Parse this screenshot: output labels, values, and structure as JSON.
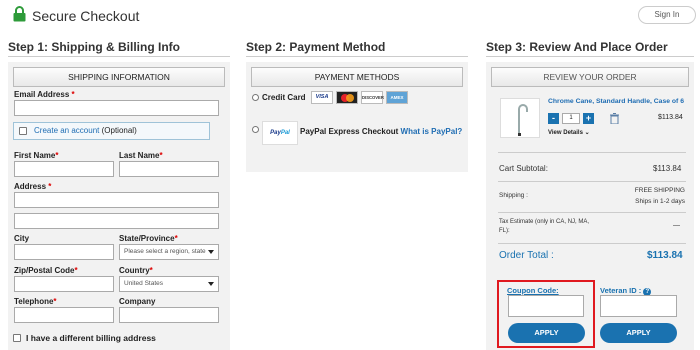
{
  "header": {
    "brand": "Secure Checkout",
    "signin": "Sign In"
  },
  "steps": {
    "step1": "Step 1: Shipping & Billing Info",
    "step2": "Step 2: Payment Method",
    "step3": "Step 3: Review And Place Order"
  },
  "shipping": {
    "panel_button": "SHIPPING INFORMATION",
    "email_label": "Email Address",
    "create_account": "Create an account",
    "optional": "(Optional)",
    "first_name": "First Name",
    "last_name": "Last Name",
    "address": "Address",
    "city": "City",
    "state": "State/Province",
    "state_placeholder": "Please select a region, state",
    "zip": "Zip/Postal Code",
    "country": "Country",
    "country_value": "United States",
    "telephone": "Telephone",
    "company": "Company",
    "billing_checkbox": "I have a different billing address",
    "required_mark": "*"
  },
  "payment": {
    "panel_button": "PAYMENT METHODS",
    "credit_card": "Credit Card",
    "paypal_label": "PayPal Express Checkout",
    "paypal_link": "What is PayPal?",
    "cards": [
      "VISA",
      "MC",
      "DISCOVER",
      "AMEX"
    ]
  },
  "review": {
    "panel_button": "REVIEW YOUR ORDER",
    "product_name": "Chrome Cane, Standard Handle, Case of 6",
    "quantity": "1",
    "price": "$113.84",
    "view_details": "View Details",
    "cart_subtotal_label": "Cart Subtotal:",
    "cart_subtotal_value": "$113.84",
    "shipping_label": "Shipping :",
    "shipping_value_1": "FREE SHIPPING",
    "shipping_value_2": "Ships in 1-2 days",
    "tax_label": "Tax Estimate (only in CA, NJ, MA, FL):",
    "tax_value": "—",
    "order_total_label": "Order Total :",
    "order_total_value": "$113.84",
    "coupon_label": "Coupon Code:",
    "veteran_label": "Veteran ID :",
    "apply_1": "APPLY",
    "apply_2": "APPLY"
  },
  "colors": {
    "accent": "#1a72b0",
    "highlight": "#e0191f",
    "lock": "#2e9b3a"
  }
}
